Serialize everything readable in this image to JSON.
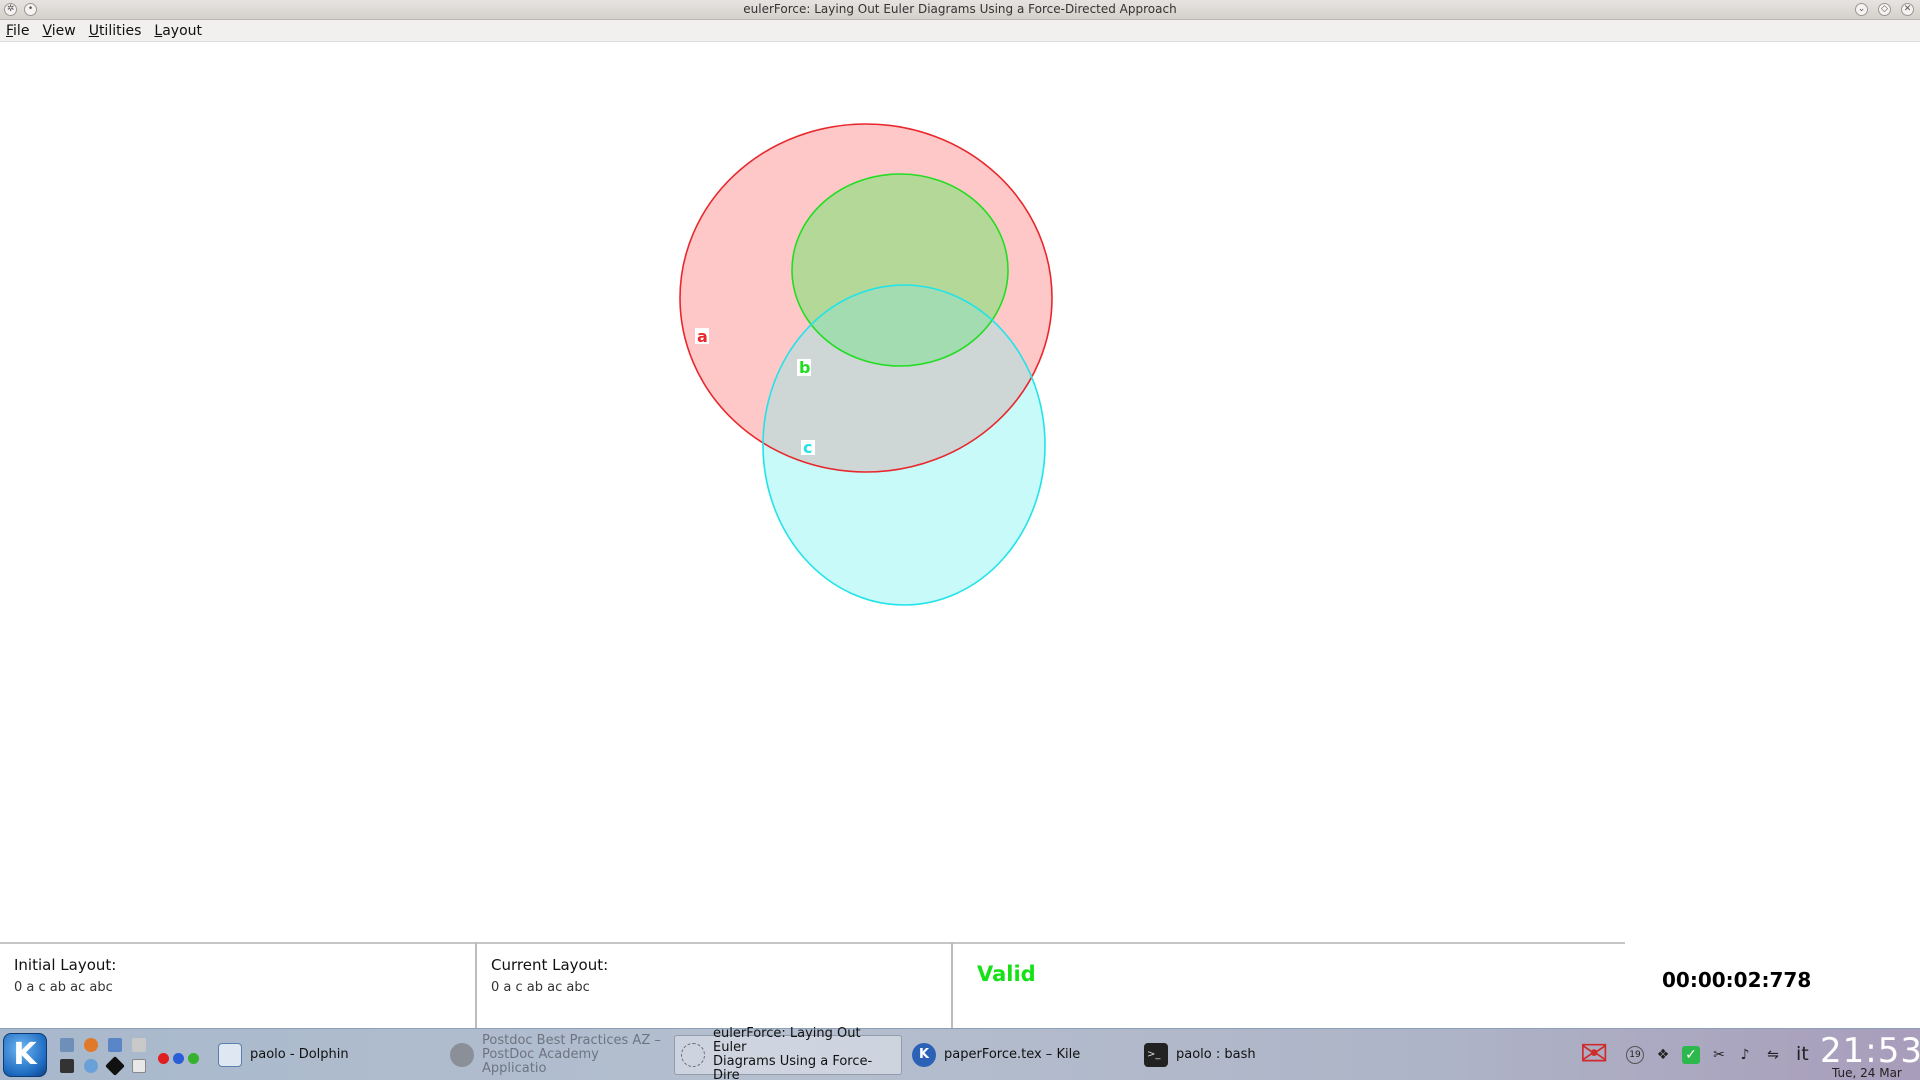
{
  "window": {
    "title": "eulerForce: Laying Out Euler Diagrams Using a Force-Directed Approach"
  },
  "menu": [
    {
      "mnemonic": "F",
      "rest": "ile"
    },
    {
      "mnemonic": "V",
      "rest": "iew"
    },
    {
      "mnemonic": "U",
      "rest": "tilities"
    },
    {
      "mnemonic": "L",
      "rest": "ayout"
    }
  ],
  "diagram": {
    "curves": [
      {
        "label": "a",
        "stroke": "#e8282c",
        "fill": "#ffc8c8"
      },
      {
        "label": "b",
        "stroke": "#22dd22",
        "fill": "#b4d898"
      },
      {
        "label": "c",
        "stroke": "#22e3e8",
        "fill": "#c8fafa"
      }
    ]
  },
  "status": {
    "initial_label": "Initial Layout:",
    "initial_value": "0 a c ab ac abc",
    "current_label": "Current Layout:",
    "current_value": "0 a c ab ac abc",
    "validity": "Valid",
    "timer": "00:00:02:778"
  },
  "taskbar": {
    "tasks": [
      {
        "label": "paolo - Dolphin"
      },
      {
        "label": "Postdoc Best Practices AZ –\nPostDoc Academy Applicatio"
      },
      {
        "label": "eulerForce: Laying Out Euler\nDiagrams Using a Force-Dire"
      },
      {
        "label": "paperForce.tex – Kile"
      },
      {
        "label": "paolo : bash"
      }
    ],
    "tray": {
      "badge": "19",
      "language": "it"
    },
    "clock": "21:53",
    "date": "Tue, 24 Mar"
  }
}
